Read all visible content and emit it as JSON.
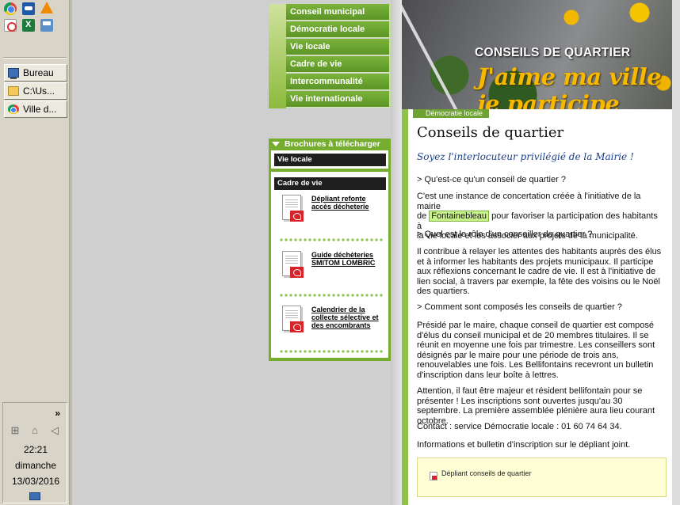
{
  "taskbar": {
    "quick_launch": [
      {
        "name": "chrome",
        "icon": "chrome-icon"
      },
      {
        "name": "app",
        "icon": "blue-app-icon"
      },
      {
        "name": "vlc",
        "icon": "vlc-cone-icon"
      },
      {
        "name": "snipping",
        "icon": "scissors-icon"
      },
      {
        "name": "excel",
        "icon": "excel-icon"
      },
      {
        "name": "disk",
        "icon": "disk-icon"
      }
    ],
    "tasks": [
      {
        "label": "Bureau",
        "icon": "desktop-icon"
      },
      {
        "label": "C:\\Us...",
        "icon": "folder-icon"
      },
      {
        "label": "Ville d...",
        "icon": "chrome-icon"
      }
    ],
    "tray": {
      "chevron": "»",
      "time": "22:21",
      "day": "dimanche",
      "date": "13/03/2016"
    }
  },
  "nav": {
    "items": [
      "Conseil municipal",
      "Démocratie locale",
      "Vie locale",
      "Cadre de vie",
      "Intercommunalité",
      "Vie internationale"
    ]
  },
  "brochures": {
    "title": "Brochures à télécharger",
    "categories": [
      "Vie locale",
      "Cadre de vie"
    ],
    "documents": [
      {
        "line1": "Dépliant refonte",
        "line2": "accès décheterie",
        "line3": ""
      },
      {
        "line1": "Guide déchèteries",
        "line2": "SMITOM LOMBRIC",
        "line3": ""
      },
      {
        "line1": "Calendrier de la",
        "line2": "collecte sélective et",
        "line3": "des encombrants"
      }
    ]
  },
  "banner": {
    "title": "CONSEILS DE QUARTIER",
    "slogan": "J'aime ma ville",
    "slogan2": "je participe"
  },
  "breadcrumb": "Démocratie locale",
  "content": {
    "title": "Conseils de quartier",
    "subtitle": "Soyez l'interlocuteur privilégié de la Mairie !",
    "q1": "> Qu'est-ce qu'un conseil de quartier ?",
    "a1_l1": "C'est une instance de concertation créée à l'initiative de la mairie",
    "a1_l2_pre": "de ",
    "a1_highlight": "Fontainebleau",
    "a1_l2_post": " pour favoriser la participation des habitants à",
    "a1_l3": "la vie locale et les associer aux projets de la municipalité.",
    "q2": "> Quel est le rôle d'un conseiller de quartier ?",
    "a2": "Il contribue à relayer les attentes des habitants auprès des élus et à informer les habitants des projets municipaux. Il participe aux réflexions concernant le cadre de vie. Il est à l'initiative de lien social, à travers par exemple, la fête des voisins ou le Noël des quartiers.",
    "q3": "> Comment sont composés les conseils de quartier ?",
    "a3": "Présidé par le maire, chaque conseil de quartier est composé d'élus du conseil municipal et de 20 membres titulaires. Il se réunit en moyenne une fois par trimestre. Les conseillers sont désignés par le maire pour une période de trois ans, renouvelables une fois. Les Bellifontains recevront un bulletin d'inscription dans leur boîte à lettres.",
    "a4": "Attention, il faut être majeur et résident bellifontain pour se présenter ! Les inscriptions sont ouvertes jusqu'au 30 septembre. La première assemblée plénière aura lieu courant octobre.",
    "contact": "Contact : service Démocratie locale : 01 60 74 64 34.",
    "info": "Informations et bulletin d'inscription sur le dépliant joint.",
    "attachment": "Dépliant conseils de quartier"
  },
  "colors": {
    "nav_green": "#6ea232",
    "accent_yellow": "#f7b800",
    "subtitle_blue": "#1a3f8a",
    "highlight": "#c9f28a"
  }
}
